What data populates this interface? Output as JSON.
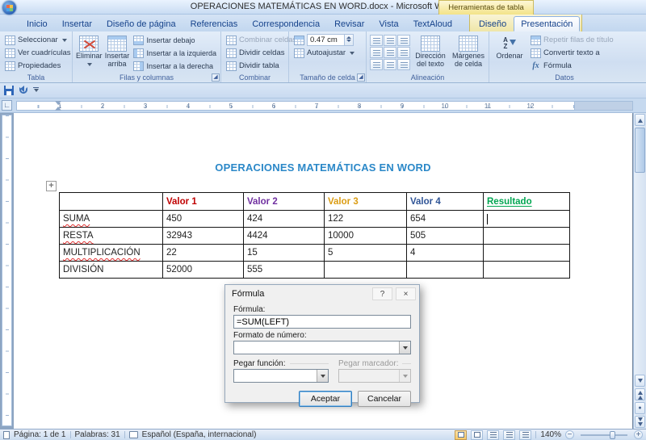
{
  "window": {
    "title": "OPERACIONES MATEMÁTICAS EN WORD.docx - Microsoft Word",
    "contextual_group_label": "Herramientas de tabla"
  },
  "ribbon": {
    "tabs": [
      "Inicio",
      "Insertar",
      "Diseño de página",
      "Referencias",
      "Correspondencia",
      "Revisar",
      "Vista",
      "TextAloud"
    ],
    "contextual_tabs": [
      "Diseño",
      "Presentación"
    ],
    "active_tab": "Presentación",
    "groups": {
      "tabla": {
        "label": "Tabla",
        "items": [
          "Seleccionar",
          "Ver cuadrículas",
          "Propiedades"
        ]
      },
      "filas_columnas": {
        "label": "Filas y columnas",
        "big": [
          "Eliminar",
          "Insertar arriba"
        ],
        "items": [
          "Insertar debajo",
          "Insertar a la izquierda",
          "Insertar a la derecha"
        ]
      },
      "combinar": {
        "label": "Combinar",
        "items": [
          "Combinar celdas",
          "Dividir celdas",
          "Dividir tabla"
        ]
      },
      "tamano_celda": {
        "label": "Tamaño de celda",
        "height_value": "0.47 cm",
        "autofit": "Autoajustar"
      },
      "alineacion": {
        "label": "Alineación",
        "text_direction": "Dirección del texto",
        "cell_margins": "Márgenes de celda"
      },
      "datos": {
        "label": "Datos",
        "sort": "Ordenar",
        "items": [
          "Repetir filas de título",
          "Convertir texto a",
          "Fórmula"
        ]
      }
    }
  },
  "ruler": {
    "numbers": [
      "1",
      "2",
      "3",
      "4",
      "5",
      "6",
      "7",
      "8",
      "9",
      "10",
      "11",
      "12"
    ]
  },
  "document": {
    "heading": "OPERACIONES MATEMÁTICAS EN WORD",
    "table": {
      "headers": [
        "",
        "Valor 1",
        "Valor 2",
        "Valor 3",
        "Valor 4",
        "Resultado"
      ],
      "rows": [
        [
          "SUMA",
          "450",
          "424",
          "122",
          "654",
          ""
        ],
        [
          "RESTA",
          "32943",
          "4424",
          "10000",
          "505",
          ""
        ],
        [
          "MULTIPLICACIÓN",
          "22",
          "15",
          "5",
          "4",
          ""
        ],
        [
          "DIVISIÓN",
          "52000",
          "555",
          "",
          "",
          ""
        ]
      ]
    }
  },
  "dialog": {
    "title": "Fórmula",
    "formula_label": "Fórmula:",
    "formula_value": "=SUM(LEFT)",
    "number_format_label": "Formato de número:",
    "paste_function_label": "Pegar función:",
    "paste_bookmark_label": "Pegar marcador:",
    "ok_label": "Aceptar",
    "cancel_label": "Cancelar"
  },
  "status_bar": {
    "page": "Página: 1 de 1",
    "words": "Palabras: 31",
    "language": "Español (España, internacional)",
    "zoom": "140%"
  },
  "icons": {
    "close": "×",
    "help": "?",
    "formula_fx": "fx",
    "sort_a": "A",
    "sort_z": "Z",
    "zoom_out": "−",
    "zoom_in": "+",
    "tab_selector": "∟",
    "table_handle": "+"
  },
  "colors": {
    "header_valor1": "#C00000",
    "header_valor2": "#7030A0",
    "header_valor3": "#DB9C12",
    "header_valor4": "#2F5496",
    "header_resultado": "#00A651",
    "heading": "#2B88C8",
    "contextual_tab": "#F3E388"
  }
}
